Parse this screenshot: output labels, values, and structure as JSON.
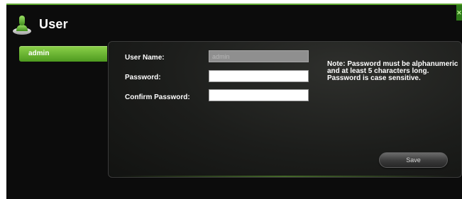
{
  "window": {
    "title": "User",
    "accent_color": "#5fa830",
    "close_icon": "close-icon"
  },
  "sidebar": {
    "items": [
      {
        "label": "admin",
        "selected": true
      }
    ]
  },
  "form": {
    "username_label": "User Name:",
    "username_value": "admin",
    "password_label": "Password:",
    "password_value": "",
    "confirm_label": "Confirm Password:",
    "confirm_value": "",
    "note": "Note: Password must be alphanumeric and at least 5 characters long. Password is case sensitive.",
    "save_label": "Save"
  },
  "icons": {
    "user": "user-icon"
  }
}
